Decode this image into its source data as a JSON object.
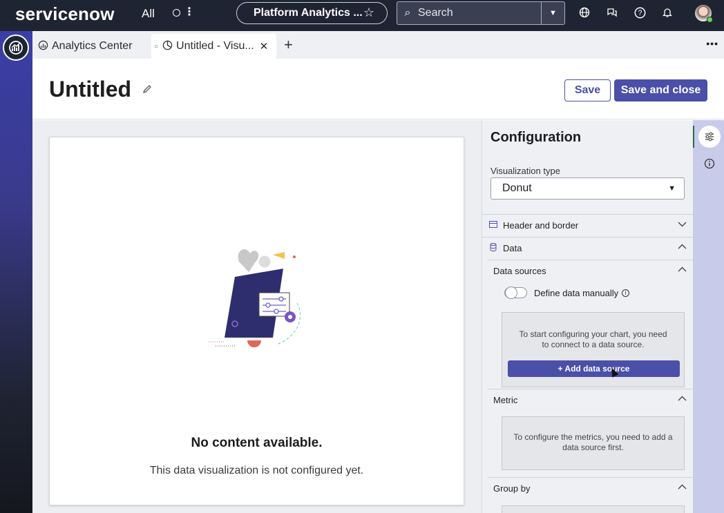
{
  "topnav": {
    "brand": "servicenow",
    "all": "All",
    "workspace_pill": "Platform Analytics ...",
    "search_placeholder": "Search",
    "icons": [
      "globe-icon",
      "chat-icon",
      "help-icon",
      "bell-icon"
    ]
  },
  "tabs": [
    {
      "label": "Analytics Center",
      "icon": "analytics-icon"
    },
    {
      "label": "Untitled - Visu...",
      "icon": "chart-icon",
      "active": true
    }
  ],
  "header": {
    "title": "Untitled",
    "save_label": "Save",
    "save_close_label": "Save and close"
  },
  "canvas": {
    "empty_title": "No content available.",
    "empty_subtitle": "This data visualization is not configured yet."
  },
  "config": {
    "title": "Configuration",
    "viz_type_label": "Visualization type",
    "viz_type_value": "Donut",
    "sections": {
      "header_border": "Header and border",
      "data": "Data",
      "data_sources": "Data sources",
      "define_manually": "Define data manually",
      "data_sources_help": "To start configuring your chart, you need to connect to a data source.",
      "add_data_source": "+ Add data source",
      "metric": "Metric",
      "metric_help": "To configure the metrics, you need to add a data source first.",
      "group_by": "Group by"
    }
  },
  "colors": {
    "nav_bg": "#1f2433",
    "accent": "#4a4fa8",
    "brand_green": "#62d84e"
  }
}
